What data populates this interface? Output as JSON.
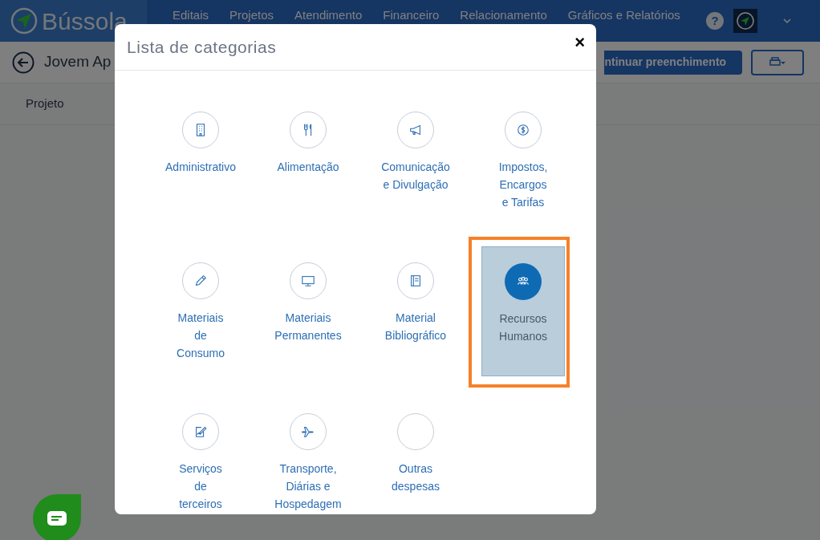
{
  "app": {
    "logo": "Bússola",
    "nav": [
      "Editais",
      "Projetos",
      "Atendimento",
      "Financeiro",
      "Relacionamento",
      "Gráficos e Relatórios"
    ],
    "help": "?"
  },
  "toolbar": {
    "title": "Jovem Ap",
    "primary_button": "ntinuar preenchimento"
  },
  "tabs": [
    {
      "label": "Projeto"
    }
  ],
  "modal": {
    "title": "Lista de categorias",
    "close": "×",
    "categories": [
      {
        "label": "Administrativo",
        "selected": false
      },
      {
        "label": "Alimentação",
        "selected": false
      },
      {
        "label": "Comunicação\ne Divulgação",
        "selected": false
      },
      {
        "label": "Impostos,\nEncargos\ne Tarifas",
        "selected": false
      },
      {
        "label": "Materiais\nde\nConsumo",
        "selected": false
      },
      {
        "label": "Materiais\nPermanentes",
        "selected": false
      },
      {
        "label": "Material\nBibliográfico",
        "selected": false
      },
      {
        "label": "Recursos\nHumanos",
        "selected": true
      },
      {
        "label": "Serviços\nde\nterceiros",
        "selected": false
      },
      {
        "label": "Transporte,\nDiárias e\nHospedagem",
        "selected": false
      },
      {
        "label": "Outras\ndespesas",
        "selected": false
      }
    ]
  }
}
